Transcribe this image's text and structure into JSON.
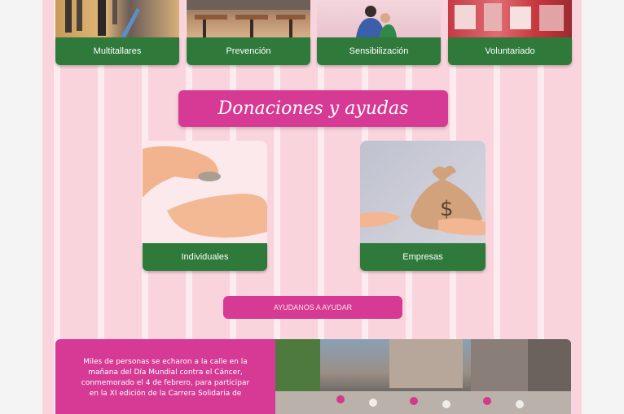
{
  "programs": [
    {
      "label": "Multitallares",
      "icon": "people-photo"
    },
    {
      "label": "Prevención",
      "icon": "classroom-photo"
    },
    {
      "label": "Sensibilización",
      "icon": "family-photo"
    },
    {
      "label": "Voluntariado",
      "icon": "volunteers-photo"
    }
  ],
  "donations": {
    "title": "Donaciones y ayudas",
    "cards": [
      {
        "label": "Individuales",
        "icon": "giving-hands-photo"
      },
      {
        "label": "Empresas",
        "icon": "money-bag-photo"
      }
    ],
    "cta_label": "AYUDANOS A AYUDAR"
  },
  "feature": {
    "text": "Miles de personas se echaron a la calle en la mañana del Día Mundial contra el Cáncer, conmemorado el 4 de febrero, para participar en la XI edición de la Carrera Solidaria de",
    "image": "street-crowd-photo"
  },
  "colors": {
    "background": "#f9d4dd",
    "accent_pink": "#d63a94",
    "label_green": "#2f7a3b"
  }
}
